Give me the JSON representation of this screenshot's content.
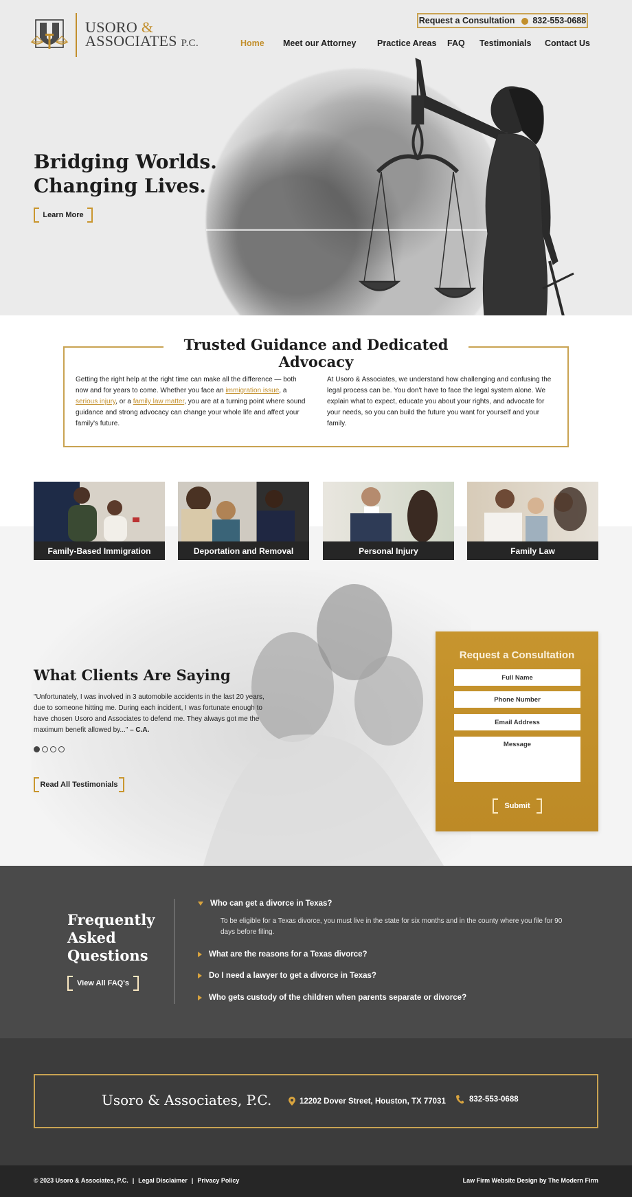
{
  "brand": {
    "logo_line1": "USORO",
    "logo_amp": "&",
    "logo_line2": "ASSOCIATES",
    "logo_suffix": "P.C.",
    "accent_color": "#c28f2c",
    "dark_color": "#262626"
  },
  "header": {
    "consult_label": "Request a Consultation",
    "phone": "832-553-0688",
    "nav": [
      {
        "label": "Home",
        "active": true
      },
      {
        "label": "Meet our Attorney",
        "active": false
      },
      {
        "label": "Practice Areas",
        "active": false
      },
      {
        "label": "FAQ",
        "active": false
      },
      {
        "label": "Testimonials",
        "active": false
      },
      {
        "label": "Contact Us",
        "active": false
      }
    ]
  },
  "hero": {
    "title_line1": "Bridging Worlds.",
    "title_line2": "Changing Lives.",
    "button": "Learn More"
  },
  "trusted": {
    "title": "Trusted Guidance and Dedicated Advocacy",
    "left_part1": "Getting the right help at the right time can make all the difference — both now and for years to come. Whether you face an ",
    "link1": "immigration issue",
    "left_part2": ", a ",
    "link2": "serious injury",
    "left_part3": ", or a ",
    "link3": "family law matter",
    "left_part4": ", you are at a turning point where sound guidance and strong advocacy can change your whole life and affect your family's future.",
    "right": "At Usoro & Associates, we understand how challenging and confusing the legal process can be. You don't have to face the legal system alone. We explain what to expect, educate you about your rights, and advocate for your needs, so you can build the future you want for yourself and your family."
  },
  "practice_areas": [
    {
      "label": "Family-Based Immigration"
    },
    {
      "label": "Deportation and Removal"
    },
    {
      "label": "Personal Injury"
    },
    {
      "label": "Family Law"
    }
  ],
  "testimonials": {
    "title": "What Clients Are Saying",
    "quote": "\"Unfortunately, I was involved in 3 automobile accidents in the last 20 years, due to someone hitting me. During each incident, I was fortunate enough to have chosen Usoro and Associates to defend me. They always got me the maximum benefit allowed by...\"",
    "author": "– C.A.",
    "slide_count": 4,
    "active_slide": 1,
    "button": "Read All Testimonials"
  },
  "consult_form": {
    "title": "Request a Consultation",
    "full_name_placeholder": "Full Name",
    "phone_placeholder": "Phone Number",
    "email_placeholder": "Email Address",
    "message_placeholder": "Message",
    "submit": "Submit"
  },
  "faq": {
    "title_line1": "Frequently",
    "title_line2": "Asked",
    "title_line3": "Questions",
    "button": "View All FAQ's",
    "items": [
      {
        "question": "Who can get a divorce in Texas?",
        "expanded": true,
        "answer": "To be eligible for a Texas divorce, you must live in the state for six months and in the county where you file for 90 days before filing."
      },
      {
        "question": "What are the reasons for a Texas divorce?",
        "expanded": false
      },
      {
        "question": "Do I need a lawyer to get a divorce in Texas?",
        "expanded": false
      },
      {
        "question": "Who gets custody of the children when parents separate or divorce?",
        "expanded": false
      }
    ]
  },
  "footer": {
    "firm_name": "Usoro & Associates, P.C.",
    "address": "12202 Dover Street, Houston, TX 77031",
    "phone": "832-553-0688",
    "copyright": "© 2023 Usoro & Associates, P.C.",
    "separator": "|",
    "legal_disclaimer": "Legal Disclaimer",
    "privacy_policy": "Privacy Policy",
    "credit": "Law Firm Website Design by The Modern Firm"
  }
}
